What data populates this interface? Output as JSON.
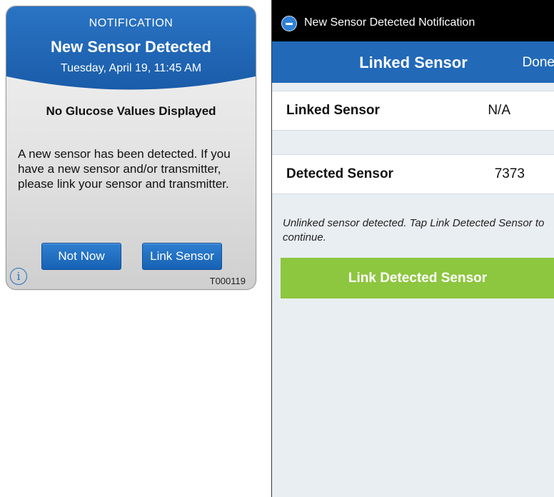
{
  "notification": {
    "label": "NOTIFICATION",
    "title": "New Sensor Detected",
    "date": "Tuesday, April 19, 11:45 AM",
    "subhead": "No Glucose Values Displayed",
    "body": "A new sensor has been detected. If you have a new sensor and/or transmitter, please link your sensor and transmitter.",
    "buttons": {
      "not_now": "Not Now",
      "link_sensor": "Link Sensor"
    },
    "info_icon": "i",
    "code": "T000119",
    "colors": {
      "header": "#1f66b5",
      "button": "#1762b4"
    }
  },
  "phone": {
    "status_title": "New Sensor Detected Notification",
    "nav": {
      "title": "Linked Sensor",
      "done": "Done"
    },
    "rows": [
      {
        "label": "Linked Sensor",
        "value": "N/A"
      },
      {
        "label": "Detected Sensor",
        "value": "7373"
      }
    ],
    "hint": "Unlinked sensor detected. Tap Link Detected Sensor to continue.",
    "link_button": "Link Detected Sensor",
    "colors": {
      "navbar": "#2269b8",
      "link_button": "#8dc63f",
      "background": "#e9eef3"
    }
  }
}
